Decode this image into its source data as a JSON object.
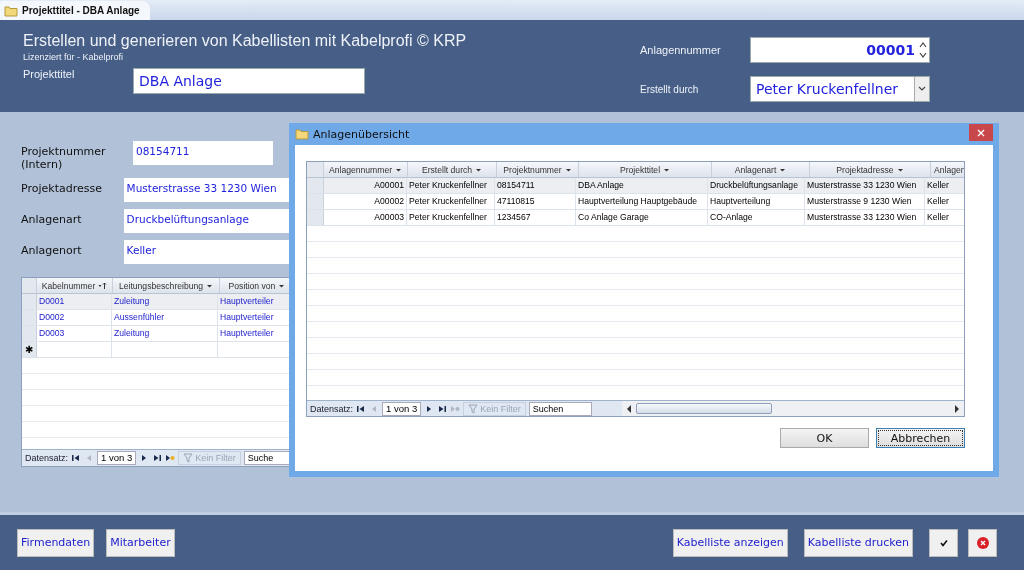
{
  "tab": {
    "title": "Projekttitel - DBA Anlage",
    "selected": true
  },
  "header": {
    "title": "Erstellen und generieren von Kabellisten mit Kabelprofi © KRP",
    "license": "Lizenziert für - Kabelprofi",
    "project_title": {
      "label": "Projekttitel",
      "value": "DBA Anlage"
    },
    "plant_number": {
      "label": "Anlagennummer",
      "value": "00001"
    },
    "created_by": {
      "label": "Erstellt durch",
      "value": "Peter Kruckenfellner"
    }
  },
  "form_fields": [
    {
      "label": "Projektnummer (Intern)",
      "value": "08154711",
      "kind": "short"
    },
    {
      "label": "Projektadresse",
      "value": "Musterstrasse 33 1230 Wien",
      "kind": "wide"
    },
    {
      "label": "Anlagenart",
      "value": "Druckbelüftungsanlage",
      "kind": "wide"
    },
    {
      "label": "Anlagenort",
      "value": "Keller",
      "kind": "wide"
    }
  ],
  "cable_table": {
    "columns": [
      {
        "title": "Kabelnummer",
        "sorted": true
      },
      {
        "title": "Leitungsbeschreibung",
        "sorted": false
      },
      {
        "title": "Position von",
        "sorted": false
      }
    ],
    "rows": [
      {
        "cells": [
          "D0001",
          "Zuleitung",
          "Hauptverteiler"
        ],
        "selected": true
      },
      {
        "cells": [
          "D0002",
          "Aussenfühler",
          "Hauptverteiler"
        ],
        "selected": false
      },
      {
        "cells": [
          "D0003",
          "Zuleitung",
          "Hauptverteiler"
        ],
        "selected": false
      }
    ],
    "new_row_marker": "✱",
    "nav": {
      "label": "Datensatz:",
      "position": "1 von 3",
      "buttons": [
        {
          "kind": "first",
          "disabled": false
        },
        {
          "kind": "prev",
          "disabled": true
        },
        {
          "kind": "next",
          "disabled": false
        },
        {
          "kind": "last",
          "disabled": false
        },
        {
          "kind": "new",
          "disabled": false
        }
      ],
      "filter": {
        "label": "Kein Filter",
        "disabled": true
      },
      "search": "Suche"
    }
  },
  "dialog": {
    "title": "Anlagenübersicht",
    "columns": [
      "Anlagennummer",
      "Erstellt durch",
      "Projektnummer",
      "Projekttitel",
      "Anlagenart",
      "Projektadresse",
      "Anlagen"
    ],
    "rows": [
      {
        "cells": [
          "A00001",
          "Peter Kruckenfellner",
          "08154711",
          "DBA Anlage",
          "Druckbelüftungsanlage",
          "Musterstrasse 33 1230 Wien",
          "Keller"
        ],
        "selected": true
      },
      {
        "cells": [
          "A00002",
          "Peter Kruckenfellner",
          "47110815",
          "Hauptverteilung Hauptgebäude",
          "Hauptverteilung",
          "Musterstrasse 9 1230 Wien",
          "Keller"
        ],
        "selected": false
      },
      {
        "cells": [
          "A00003",
          "Peter Kruckenfellner",
          "1234567",
          "Co Anlage Garage",
          "CO-Anlage",
          "Musterstrasse 33 1230 Wien",
          "Keller"
        ],
        "selected": false
      }
    ],
    "nav": {
      "label": "Datensatz:",
      "position": "1 von 3",
      "buttons": [
        {
          "kind": "first",
          "disabled": false
        },
        {
          "kind": "prev",
          "disabled": true
        },
        {
          "kind": "next",
          "disabled": false
        },
        {
          "kind": "last",
          "disabled": false
        },
        {
          "kind": "new",
          "disabled": true
        }
      ],
      "filter": {
        "label": "Kein Filter",
        "disabled": true
      },
      "search": "Suchen"
    },
    "buttons": [
      {
        "label": "OK",
        "focused": false
      },
      {
        "label": "Abbrechen",
        "focused": true
      }
    ]
  },
  "footer": {
    "left_buttons": [
      "Firmendaten",
      "Mitarbeiter"
    ],
    "right_buttons": [
      "Kabelliste anzeigen",
      "Kabelliste drucken"
    ],
    "icon_buttons": [
      {
        "kind": "confirm"
      },
      {
        "kind": "cancel"
      }
    ]
  }
}
